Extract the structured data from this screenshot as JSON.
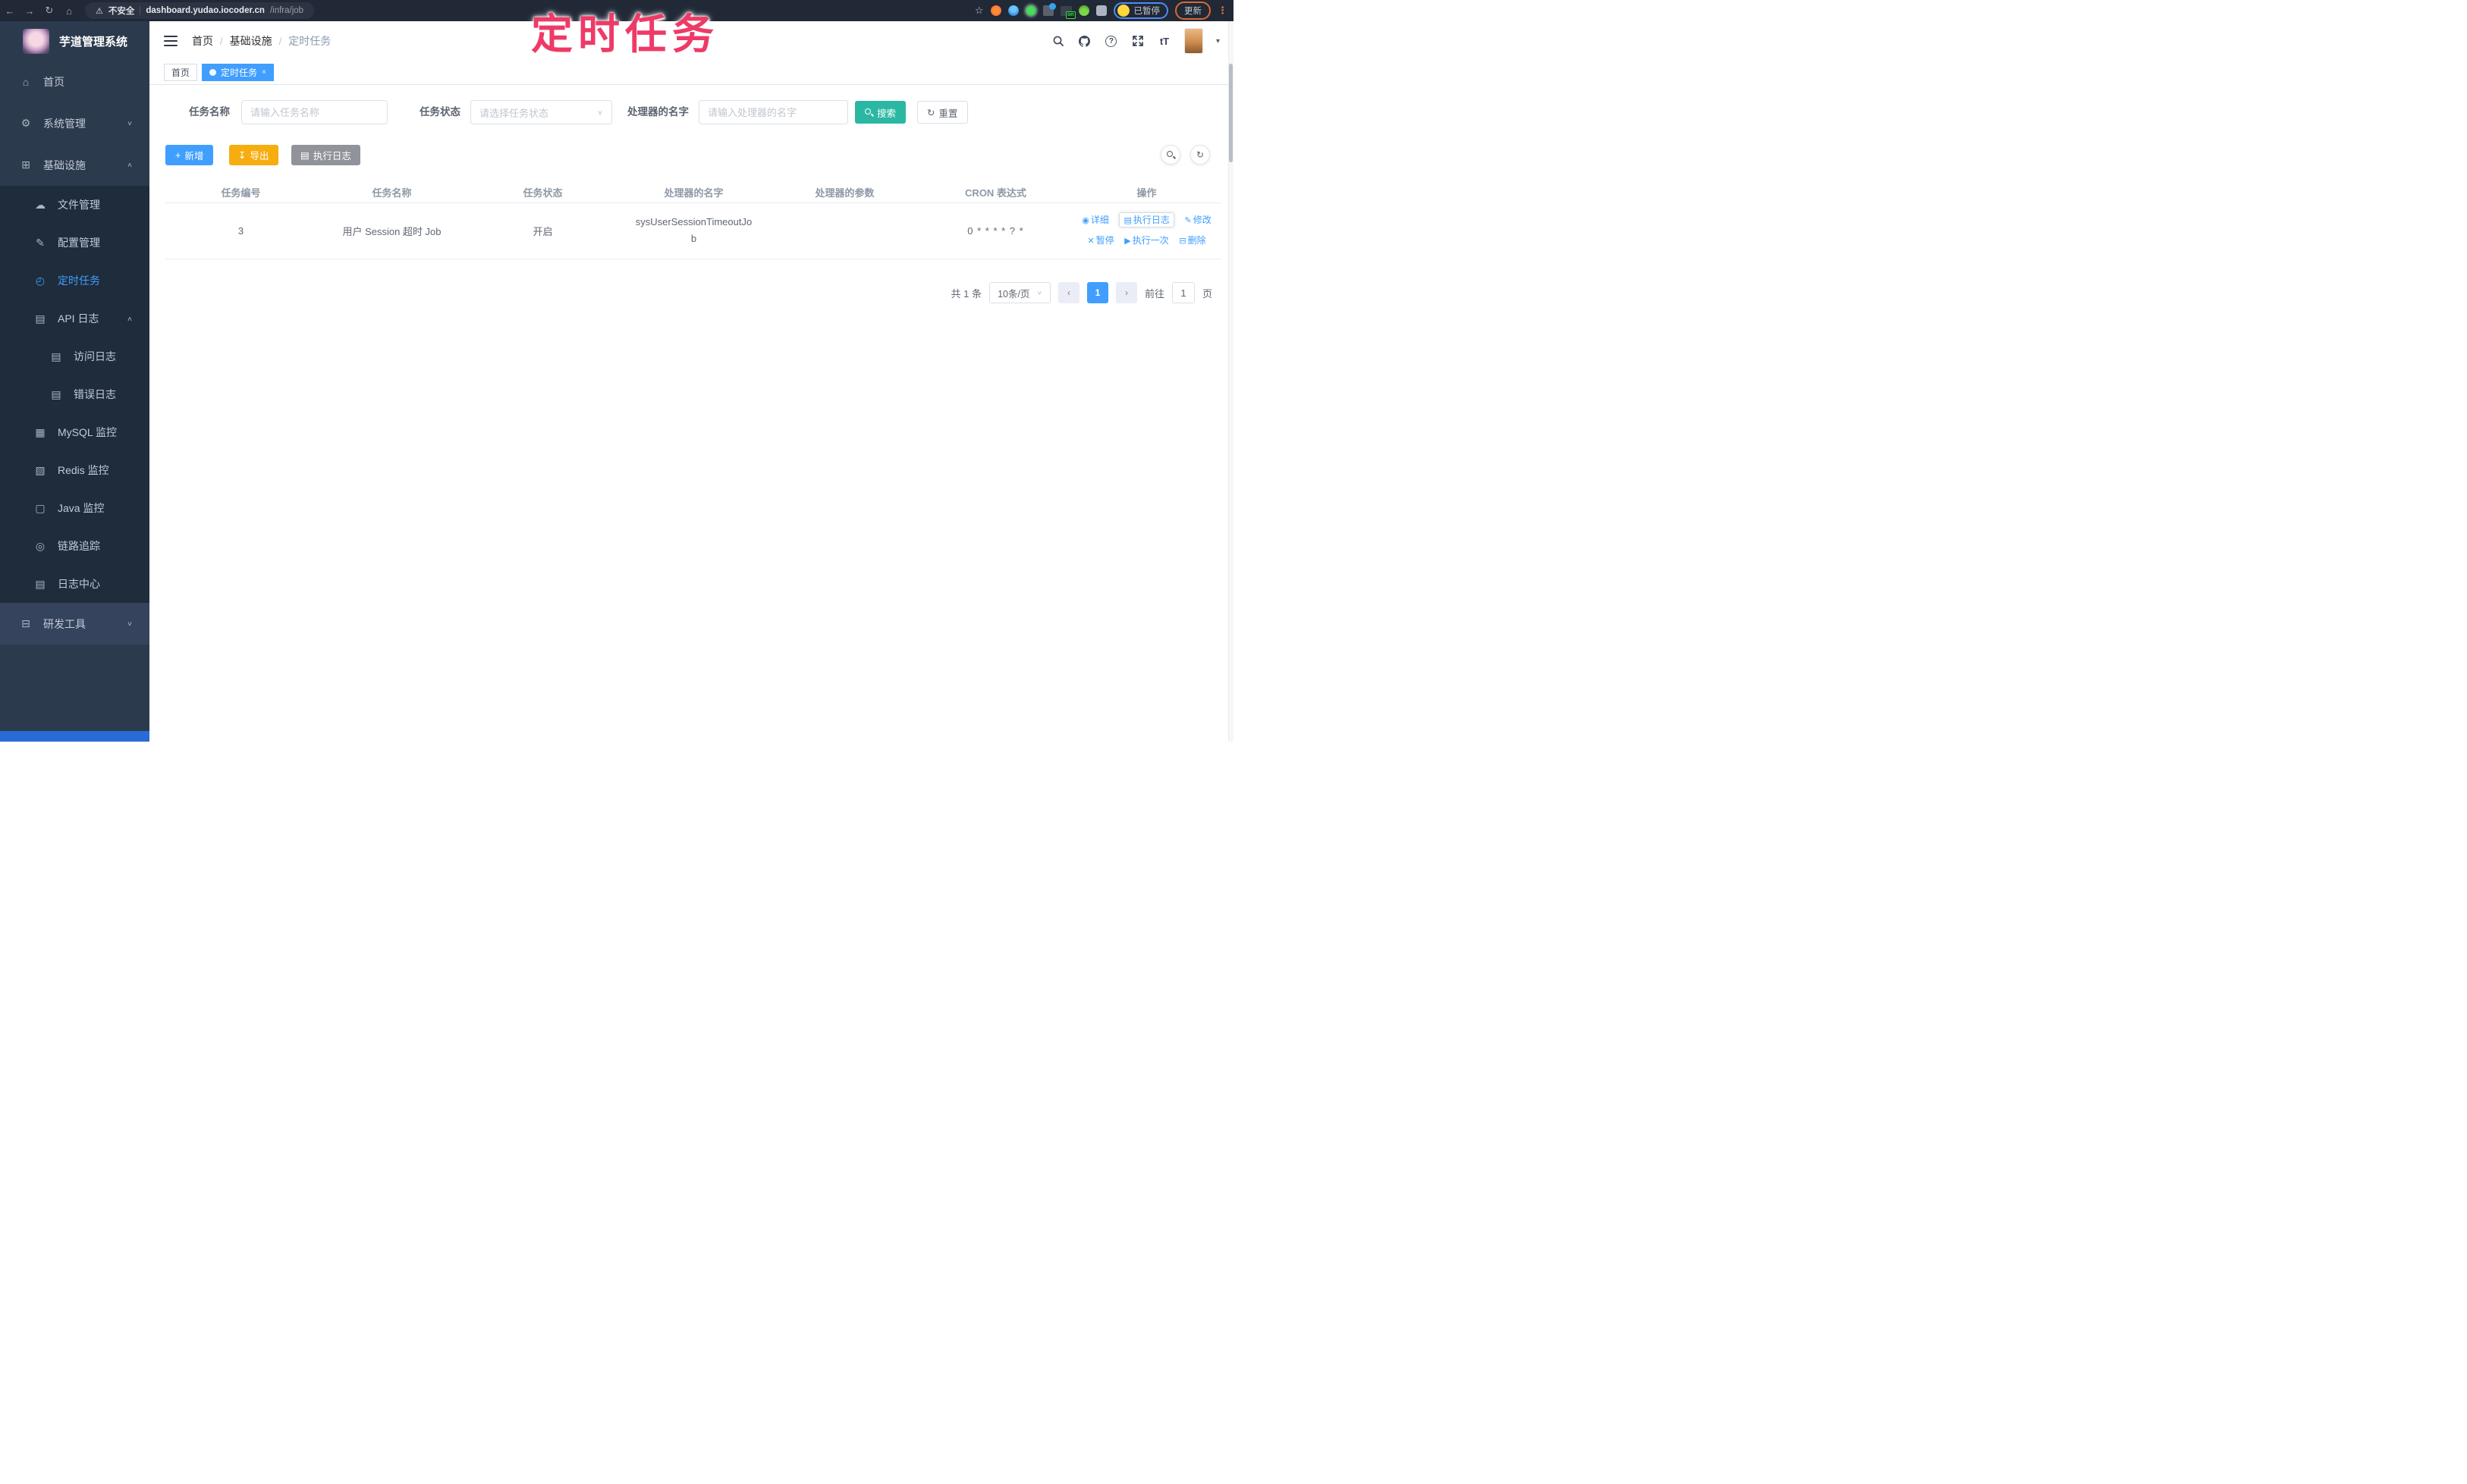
{
  "browser": {
    "security_label": "不安全",
    "url_host": "dashboard.yudao.iocoder.cn",
    "url_path": "/infra/job",
    "paused_label": "已暂停",
    "update_label": "更新",
    "extension_on_badge": "on"
  },
  "annotation": {
    "text": "定时任务"
  },
  "icons": {
    "back": "←",
    "forward": "→",
    "reload": "↻",
    "home": "⌂",
    "warning": "⚠",
    "star": "☆",
    "kebab": "⋮",
    "text_size": "tT",
    "question": "?",
    "plus": "+",
    "download": "↧",
    "list": "▤",
    "reset": "↻",
    "refresh": "↻",
    "caret_down": "∨",
    "caret_up": "∧",
    "nav_caret": "▾",
    "eye": "◉",
    "doc": "▤",
    "edit": "✎",
    "pause": "✕",
    "play": "▶",
    "trash": "⊟"
  },
  "sidebar": {
    "title": "芋道管理系统",
    "items": [
      {
        "label": "首页",
        "glyph": "⌂",
        "arrow": ""
      },
      {
        "label": "系统管理",
        "glyph": "⚙",
        "arrow": "∨"
      },
      {
        "label": "基础设施",
        "glyph": "⊞",
        "arrow": "∧"
      },
      {
        "label": "文件管理",
        "glyph": "☁",
        "arrow": ""
      },
      {
        "label": "配置管理",
        "glyph": "✎",
        "arrow": ""
      },
      {
        "label": "定时任务",
        "glyph": "◴",
        "arrow": ""
      },
      {
        "label": "API 日志",
        "glyph": "▤",
        "arrow": "∧"
      },
      {
        "label": "访问日志",
        "glyph": "▤",
        "arrow": ""
      },
      {
        "label": "错误日志",
        "glyph": "▤",
        "arrow": ""
      },
      {
        "label": "MySQL 监控",
        "glyph": "▦",
        "arrow": ""
      },
      {
        "label": "Redis 监控",
        "glyph": "▧",
        "arrow": ""
      },
      {
        "label": "Java 监控",
        "glyph": "▢",
        "arrow": ""
      },
      {
        "label": "链路追踪",
        "glyph": "◎",
        "arrow": ""
      },
      {
        "label": "日志中心",
        "glyph": "▤",
        "arrow": ""
      },
      {
        "label": "研发工具",
        "glyph": "⊟",
        "arrow": "∨"
      }
    ]
  },
  "breadcrumb": {
    "items": [
      "首页",
      "基础设施",
      "定时任务"
    ],
    "separator": "/"
  },
  "tags": [
    {
      "label": "首页"
    },
    {
      "label": "定时任务",
      "close": "×"
    }
  ],
  "filters": {
    "name_label": "任务名称",
    "name_placeholder": "请输入任务名称",
    "status_label": "任务状态",
    "status_placeholder": "请选择任务状态",
    "handler_label": "处理器的名字",
    "handler_placeholder": "请输入处理器的名字",
    "search_label": "搜索",
    "reset_label": "重置"
  },
  "toolbar": {
    "add_label": "新增",
    "export_label": "导出",
    "exec_log_label": "执行日志"
  },
  "table": {
    "columns": [
      "任务编号",
      "任务名称",
      "任务状态",
      "处理器的名字",
      "处理器的参数",
      "CRON 表达式",
      "操作"
    ],
    "rows": [
      {
        "id": "3",
        "name": "用户 Session 超时 Job",
        "status": "开启",
        "handler": "sysUserSessionTimeoutJob",
        "param": "",
        "cron": "0 * * * * ? *"
      }
    ],
    "actions": [
      {
        "label": "详细"
      },
      {
        "label": "执行日志"
      },
      {
        "label": "修改"
      },
      {
        "label": "暂停"
      },
      {
        "label": "执行一次"
      },
      {
        "label": "删除"
      }
    ]
  },
  "pagination": {
    "total_label": "共 1 条",
    "page_size": "10条/页",
    "prev": "‹",
    "current_page": "1",
    "next": "›",
    "goto_label": "前往",
    "goto_value": "1",
    "page_unit": "页"
  },
  "colors": {
    "primary": "#409eff",
    "search_button": "#2cb7a3",
    "export_button": "#f6ad0f",
    "info_button": "#909399",
    "annotation_pink": "#ee3a67",
    "sidebar_bg": "#2c3a4d",
    "submenu_bg": "#1f2c3c",
    "browser_bar_bg": "#212836"
  }
}
